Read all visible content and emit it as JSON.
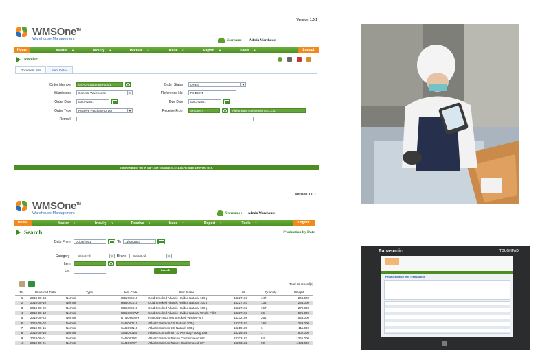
{
  "receive_screen": {
    "version": "Version 1.0.1",
    "logo_title": "WMSOne",
    "logo_tm": "TM",
    "logo_subtitle": "Warehouse Management",
    "username_label": "Username :",
    "username_value": "Admin Warehouse",
    "menu": {
      "home": "Home",
      "items": [
        "Master",
        "Inquiry",
        "Receive",
        "Issue",
        "Report",
        "Tools"
      ],
      "logout": "Logout"
    },
    "page_title": "Receive",
    "tabs": [
      "Document Info",
      "Item Detail"
    ],
    "form": {
      "order_number_label": "Order Number",
      "order_number_value": "GR-CH-20180829-0001",
      "warehouse_label": "Warehouse",
      "warehouse_value": "General Warehouse",
      "order_date_label": "Order Date",
      "order_date_value": "03/07/2561",
      "order_type_label": "Order Type",
      "order_type_value": "Receive Purchase Order",
      "remark_label": "Remark",
      "remark_value": "",
      "order_status_label": "Order Status",
      "order_status_value": "OPEN",
      "reference_no_label": "Reference No.",
      "reference_no_value": "PO18071",
      "due_date_label": "Due Date",
      "due_date_value": "03/07/2561",
      "receive_from_label": "Receive From",
      "receive_from_code": "SP00047",
      "receive_from_name": "Alpha Bate Corporation Co.,Ltd."
    },
    "footer": "Empowering to you by Bar Code (Thailand) CO.,LTD All Right Reserved 2018."
  },
  "search_screen": {
    "version": "Version 1.0.1",
    "logo_title": "WMSOne",
    "logo_tm": "TM",
    "logo_subtitle": "Warehouse Management",
    "username_label": "Username :",
    "username_value": "Admin Warehouse",
    "menu": {
      "home": "Home",
      "items": [
        "Master",
        "Inquiry",
        "Receive",
        "Issue",
        "Report",
        "Tools"
      ],
      "logout": "Logout"
    },
    "page_title": "Search",
    "page_subtitle": "Production by Date",
    "filters": {
      "date_from_label": "Date From:",
      "date_from_value": "01/08/2561",
      "to_label": "To",
      "to_value": "11/08/2561",
      "category_label": "Category :",
      "category_value": "--Select All--",
      "brand_label": "Brand",
      "brand_value": "--Select All--",
      "item_label": "Item:",
      "item_value": "",
      "lot_label": "Lot :",
      "lot_value": "",
      "search_button": "Search"
    },
    "total": "Total 15 record(s)",
    "columns": [
      "No.",
      "Produced Date",
      "Type",
      "Item Code",
      "Item Name",
      "lot",
      "Quantity",
      "Weight"
    ],
    "rows": [
      [
        "1",
        "2018-08-18",
        "Normal",
        "HBNOCS10",
        "Cold Smoked Atlantic Halibut Natural 100 g",
        "18227193",
        "147",
        "246.000"
      ],
      [
        "2",
        "2018-08-19",
        "Normal",
        "HBNOCS10",
        "Cold Smoked Atlantic Halibut Natural 100 g",
        "18227193",
        "134",
        "235.000"
      ],
      [
        "3",
        "2018-08-20",
        "Normal",
        "HBNOCS10",
        "Cold Smoked Atlantic Halibut Natural 100 g",
        "18227193",
        "167",
        "270.000"
      ],
      [
        "4",
        "2018-08-18",
        "Normal",
        "HBNOCSWF",
        "Cold Smoked Atlantic Halibut Natural Whole Fillet",
        "18227193",
        "66",
        "571.000"
      ],
      [
        "5",
        "2018-08-23",
        "Normal",
        "RTNOHSWH",
        "Rainbow Trout Hot Smoked Whole Fish",
        "18232198",
        "264",
        "565.000"
      ],
      [
        "6",
        "2018-08-02",
        "Normal",
        "SANOCN10",
        "Atlantic Salmon CS Natural 100 g",
        "18203182",
        "166",
        "269.000"
      ],
      [
        "7",
        "2018-08-15",
        "Normal",
        "SANOCN10",
        "Atlantic Salmon CS Natural 100 g",
        "18219189",
        "6",
        "111.000"
      ],
      [
        "8",
        "2018-08-16",
        "Normal",
        "SANOCN50",
        "Atlantic CS Salmon 10 Pcs 50g - 500g total",
        "18219189",
        "1",
        "502.000"
      ],
      [
        "9",
        "2018-08-01",
        "Normal",
        "SANOCWF",
        "Atlantic Salmon Nature Cold smoked WF",
        "18203182",
        "54",
        "1265.000"
      ],
      [
        "10",
        "2018-08-01",
        "Normal",
        "SANOCWF",
        "Atlantic Salmon Nature Cold smoked WF",
        "18203182",
        "69",
        "1484.000"
      ]
    ]
  },
  "tablet_photo": {
    "brand": "Panasonic",
    "brand_right": "TOUGHPAD",
    "screen_title": "Product Batch RM Transaction"
  },
  "colors": {
    "green": "#4b8e22",
    "orange": "#f08a1c",
    "link_blue": "#2a6db5"
  }
}
